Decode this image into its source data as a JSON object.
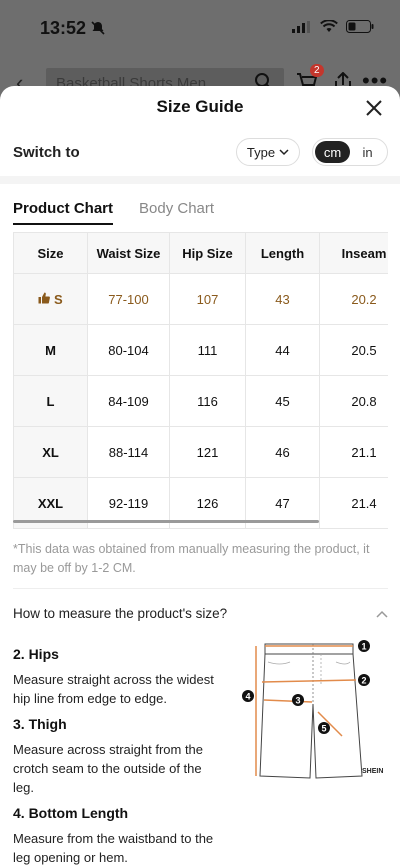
{
  "status": {
    "time": "13:52"
  },
  "background_app": {
    "search_text": "Basketball Shorts Men",
    "cart_badge": "2"
  },
  "sheet": {
    "title": "Size Guide",
    "switch_label": "Switch to",
    "type_label": "Type",
    "units": [
      "cm",
      "in"
    ],
    "active_unit": "cm",
    "tabs": [
      "Product Chart",
      "Body Chart"
    ],
    "active_tab": "Product Chart"
  },
  "table": {
    "headers": [
      "Size",
      "Waist Size",
      "Hip Size",
      "Length",
      "Inseam"
    ],
    "rows": [
      [
        "S",
        "77-100",
        "107",
        "43",
        "20.2"
      ],
      [
        "M",
        "80-104",
        "111",
        "44",
        "20.5"
      ],
      [
        "L",
        "84-109",
        "116",
        "45",
        "20.8"
      ],
      [
        "XL",
        "88-114",
        "121",
        "46",
        "21.1"
      ],
      [
        "XXL",
        "92-119",
        "126",
        "47",
        "21.4"
      ]
    ],
    "highlight_row": 0
  },
  "note": "*This data was obtained from manually measuring the product, it may be off by 1-2 CM.",
  "measure": {
    "header": "How to measure the product's size?",
    "steps": [
      {
        "title": "2. Hips",
        "desc": "Measure straight across the widest hip line from edge to edge."
      },
      {
        "title": "3. Thigh",
        "desc": "Measure across straight from the crotch seam to the outside of the leg."
      },
      {
        "title": "4. Bottom Length",
        "desc": "Measure from the waistband to the leg opening or hem."
      }
    ],
    "diagram_labels": [
      "1",
      "2",
      "3",
      "4",
      "5"
    ],
    "brand": "SHEIN"
  },
  "colors": {
    "highlight": "#8a5a1c",
    "accent_dark": "#222222"
  }
}
